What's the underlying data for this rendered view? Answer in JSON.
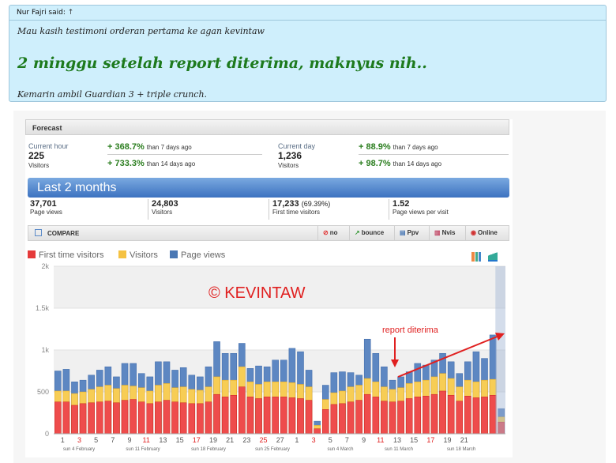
{
  "quote": {
    "author": "Nur Fajri said:",
    "arrow": "↑",
    "line1": "Mau kasih testimoni orderan pertama ke agan kevintaw",
    "headline": "2 minggu setelah report diterima, maknyus nih..",
    "line2": "Kemarin ambil Guardian 3 + triple crunch."
  },
  "forecast": {
    "title": "Forecast",
    "current_hour": {
      "label": "Current hour",
      "value": "225",
      "unit": "Visitors"
    },
    "hour_changes": [
      {
        "pct": "+ 368.7%",
        "text": "than 7 days ago"
      },
      {
        "pct": "+ 733.3%",
        "text": "than 14 days ago"
      }
    ],
    "current_day": {
      "label": "Current day",
      "value": "1,236",
      "unit": "Visitors"
    },
    "day_changes": [
      {
        "pct": "+ 88.9%",
        "text": "than 7 days ago"
      },
      {
        "pct": "+ 98.7%",
        "text": "than 14 days ago"
      }
    ]
  },
  "period": {
    "title": "Last 2 months",
    "stats": [
      {
        "value": "37,701",
        "extra": "",
        "label": "Page views"
      },
      {
        "value": "24,803",
        "extra": "",
        "label": "Visitors"
      },
      {
        "value": "17,233",
        "extra": "(69.39%)",
        "label": "First time visitors"
      },
      {
        "value": "1.52",
        "extra": "",
        "label": "Page views per visit"
      }
    ]
  },
  "compare": {
    "title": "COMPARE",
    "buttons": [
      {
        "label": "no",
        "icon": "no-icon"
      },
      {
        "label": "bounce",
        "icon": "bounce-icon"
      },
      {
        "label": "Ppv",
        "icon": "ppv-icon"
      },
      {
        "label": "Nvis",
        "icon": "nvis-icon"
      },
      {
        "label": "Online",
        "icon": "online-icon"
      }
    ]
  },
  "legend": [
    {
      "name": "First time visitors",
      "color": "#e53a3a"
    },
    {
      "name": "Visitors",
      "color": "#f5c242"
    },
    {
      "name": "Page views",
      "color": "#4a78b4"
    }
  ],
  "annotations": {
    "watermark": "© KEVINTAW",
    "report": "report diterima"
  },
  "chart_data": {
    "type": "bar",
    "y_ticks": [
      "0",
      "500",
      "1k",
      "1.5k",
      "2k"
    ],
    "ylim": [
      0,
      2000
    ],
    "x_tick_labels": [
      "1",
      "3",
      "5",
      "7",
      "9",
      "11",
      "13",
      "15",
      "17",
      "19",
      "21",
      "23",
      "25",
      "27",
      "1",
      "3",
      "5",
      "7",
      "9",
      "11",
      "13",
      "15",
      "17",
      "19",
      "21"
    ],
    "red_ticks": [
      "3",
      "11",
      "17",
      "25"
    ],
    "week_labels": [
      "sun 4 February",
      "sun 11 February",
      "sun 18 February",
      "sun 25 February",
      "sun 4 March",
      "sun 11 March",
      "sun 18 March"
    ],
    "series": [
      {
        "name": "Page views",
        "values": [
          750,
          770,
          620,
          640,
          700,
          760,
          800,
          680,
          840,
          840,
          720,
          680,
          860,
          860,
          760,
          790,
          700,
          680,
          800,
          1100,
          960,
          960,
          1080,
          780,
          810,
          800,
          880,
          880,
          1020,
          980,
          760,
          150,
          580,
          730,
          740,
          730,
          700,
          1130,
          960,
          800,
          640,
          680,
          740,
          840,
          820,
          880,
          960,
          860,
          720,
          860,
          980,
          900,
          1180,
          300
        ]
      },
      {
        "name": "Visitors",
        "values": [
          510,
          510,
          480,
          500,
          530,
          560,
          580,
          540,
          580,
          570,
          550,
          510,
          580,
          600,
          550,
          560,
          530,
          520,
          560,
          680,
          640,
          640,
          800,
          620,
          590,
          620,
          620,
          620,
          610,
          590,
          560,
          100,
          410,
          490,
          510,
          560,
          580,
          660,
          620,
          560,
          530,
          550,
          600,
          620,
          640,
          680,
          720,
          660,
          560,
          640,
          620,
          640,
          650,
          200
        ]
      },
      {
        "name": "First time visitors",
        "values": [
          380,
          380,
          340,
          360,
          370,
          380,
          390,
          370,
          400,
          410,
          380,
          360,
          380,
          400,
          380,
          370,
          360,
          360,
          380,
          470,
          440,
          460,
          560,
          440,
          420,
          440,
          440,
          440,
          430,
          420,
          400,
          60,
          290,
          350,
          360,
          380,
          400,
          470,
          440,
          390,
          380,
          390,
          420,
          440,
          450,
          470,
          510,
          460,
          390,
          450,
          430,
          440,
          460,
          140
        ]
      }
    ]
  }
}
